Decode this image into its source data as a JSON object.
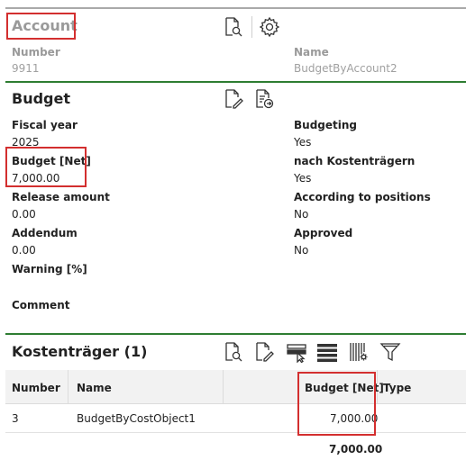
{
  "account": {
    "title": "Account",
    "number_label": "Number",
    "number_value": "9911",
    "name_label": "Name",
    "name_value": "BudgetByAccount2",
    "icons": [
      "document-search-icon",
      "gear-icon"
    ]
  },
  "budget": {
    "title": "Budget",
    "icons": [
      "document-edit-icon",
      "document-forward-icon"
    ],
    "fields_left": [
      {
        "label": "Fiscal year",
        "value": "2025"
      },
      {
        "label": "Budget [Net]",
        "value": "7,000.00"
      },
      {
        "label": "Release amount",
        "value": "0.00"
      },
      {
        "label": "Addendum",
        "value": "0.00"
      },
      {
        "label": "Warning [%]",
        "value": ""
      },
      {
        "label": "Comment",
        "value": ""
      }
    ],
    "fields_right": [
      {
        "label": "Budgeting",
        "value": "Yes"
      },
      {
        "label": "nach Kostenträgern",
        "value": "Yes"
      },
      {
        "label": "According to positions",
        "value": "No"
      },
      {
        "label": "Approved",
        "value": "No"
      }
    ]
  },
  "cost_objects": {
    "title": "Kostenträger (1)",
    "icons": [
      "document-search-icon",
      "document-edit-icon",
      "select-rows-icon",
      "list-view-icon",
      "column-settings-icon",
      "filter-icon"
    ],
    "columns": [
      "Number",
      "Name",
      "Budget [Net]",
      "Type"
    ],
    "rows": [
      {
        "number": "3",
        "name": "BudgetByCostObject1",
        "budget": "7,000.00",
        "type": ""
      }
    ],
    "total": "7,000.00"
  },
  "colors": {
    "accent_line": "#2e7d32",
    "highlight_box": "#d32f2f",
    "muted_text": "#9a9a9a"
  }
}
